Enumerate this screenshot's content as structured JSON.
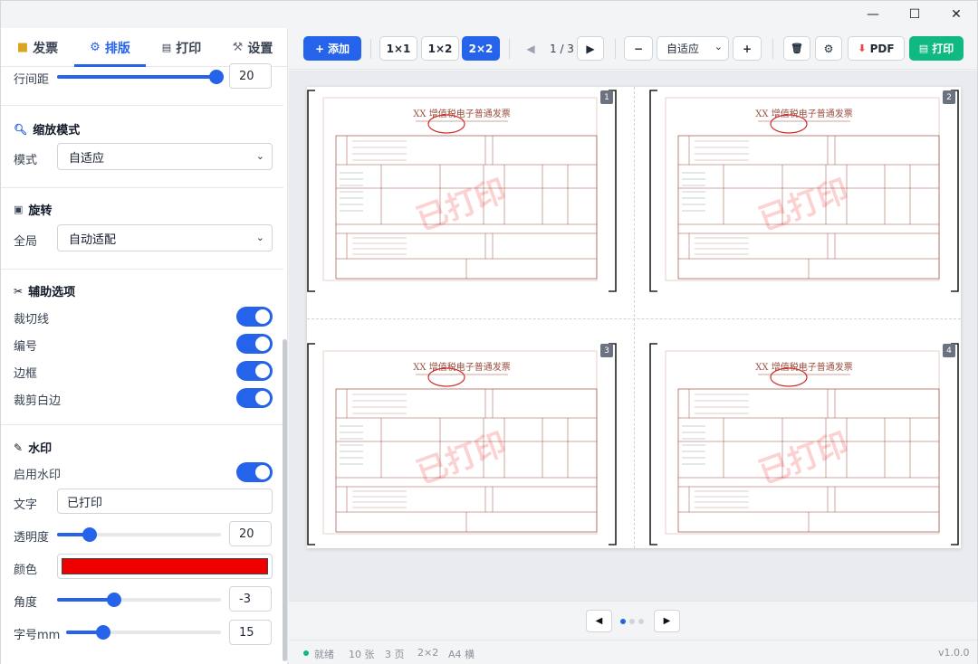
{
  "window": {
    "controls": {
      "minimize": "—",
      "maximize": "☐",
      "close": "✕"
    }
  },
  "sidebar": {
    "tabs": [
      {
        "icon": "folder-icon",
        "glyph": "📁",
        "label": "发票"
      },
      {
        "icon": "gear-icon",
        "glyph": "⚙",
        "label": "排版"
      },
      {
        "icon": "printer-icon",
        "glyph": "🖶",
        "label": "打印"
      },
      {
        "icon": "wrench-icon",
        "glyph": "🔧",
        "label": "设置"
      }
    ],
    "line_spacing": {
      "label": "行间距",
      "value": "20",
      "level": 1.0
    },
    "zoom": {
      "title": "缩放模式",
      "mode_label": "模式",
      "mode_value": "自适应"
    },
    "rotate": {
      "title": "旋转",
      "global_label": "全局",
      "global_value": "自动适配"
    },
    "aux": {
      "title": "辅助选项",
      "items": [
        {
          "label": "裁切线",
          "on": true
        },
        {
          "label": "编号",
          "on": true
        },
        {
          "label": "边框",
          "on": true
        },
        {
          "label": "裁剪白边",
          "on": true
        }
      ]
    },
    "watermark": {
      "title": "水印",
      "enable_label": "启用水印",
      "text_label": "文字",
      "text_value": "已打印",
      "opacity_label": "透明度",
      "opacity_value": "20",
      "opacity_level": 0.2,
      "color_label": "颜色",
      "color_value": "#ee0000",
      "angle_label": "角度",
      "angle_value": "-3",
      "angle_level": 0.35,
      "size_label": "字号mm",
      "size_value": "15",
      "size_level": 0.24
    }
  },
  "toolbar": {
    "add": "添加",
    "layouts": [
      "1×1",
      "1×2",
      "2×2"
    ],
    "page_indicator": "1 / 3",
    "zoom_minus": "−",
    "zoom_value": "自适应",
    "zoom_plus": "+",
    "pdf": "PDF",
    "print": "打印"
  },
  "preview": {
    "invoice_title": "XX 增值税电子普通发票",
    "watermark_text": "已打印",
    "cells": [
      "1",
      "2",
      "3",
      "4"
    ]
  },
  "status": {
    "ready": "就绪",
    "count": "10 张",
    "pages": "3 页",
    "layout": "2×2",
    "paper": "A4 横",
    "version": "v1.0.0"
  },
  "colors": {
    "accent": "#2563eb",
    "success": "#10b981",
    "watermark": "#ee0000",
    "invoice_line": "#9b4f3f"
  }
}
